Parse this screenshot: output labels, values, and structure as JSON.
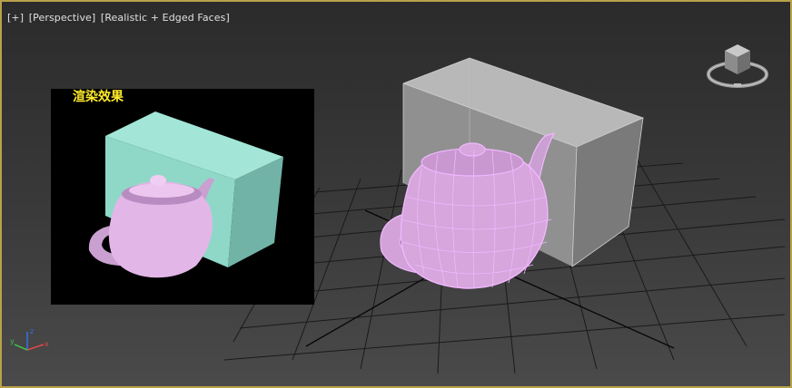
{
  "viewport": {
    "labels": [
      "[+]",
      "[Perspective]",
      "[Realistic + Edged Faces]"
    ],
    "active_border_color": "#b8a24a"
  },
  "render_preview": {
    "title": "渲染效果",
    "title_color": "#ffeb2a",
    "background": "#000000",
    "box_color": "#8fd8c8",
    "teapot_color": "#e3b6e8"
  },
  "scene": {
    "box_color": "#9a9a9a",
    "teapot_color": "#d6a6dc",
    "wire_color": "#f1b7ff"
  },
  "viewcube": {
    "icon": "viewcube-icon"
  },
  "axis_gizmo": {
    "x": "x",
    "y": "y",
    "z": "z"
  }
}
